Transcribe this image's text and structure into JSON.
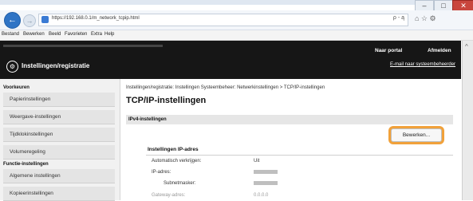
{
  "browser": {
    "address": "https://192.168.0.1/m_network_tcpip.html",
    "address_tools": "ρ - ą",
    "right_icons": "⌂ ☆ ⚙",
    "menu": [
      "Bestand",
      "Bewerken",
      "Beeld",
      "Favorieten",
      "Extra",
      "Help"
    ]
  },
  "header": {
    "title": "Instellingen/registratie",
    "portal": "Naar portal",
    "logout": "Afmelden",
    "mail": "E-mail naar systeembeheerder"
  },
  "sidebar": {
    "section1": "Voorkeuren",
    "items1": [
      "Papierinstellingen",
      "Weergave-instellingen",
      "Tijdklokinstellingen",
      "Volumeregeling"
    ],
    "section2": "Functie-instellingen",
    "items2": [
      "Algemene instellingen",
      "Kopieerinstellingen"
    ]
  },
  "main": {
    "breadcrumb": "Instellingen/registratie: Instellingen Systeembeheer: Netwerkinstellingen > TCP/IP-instellingen",
    "title": "TCP/IP-instellingen",
    "section": "IPv4-instellingen",
    "edit": "Bewerken...",
    "subsection": "Instellingen IP-adres",
    "rows": [
      {
        "label": "Automatisch verkrijgen:",
        "value": "Uit"
      },
      {
        "label": "IP-adres:",
        "value": ""
      },
      {
        "label": "Subnetmasker:",
        "value": ""
      },
      {
        "label": "Gateway-adres:",
        "value": "0.0.0.0"
      }
    ]
  }
}
